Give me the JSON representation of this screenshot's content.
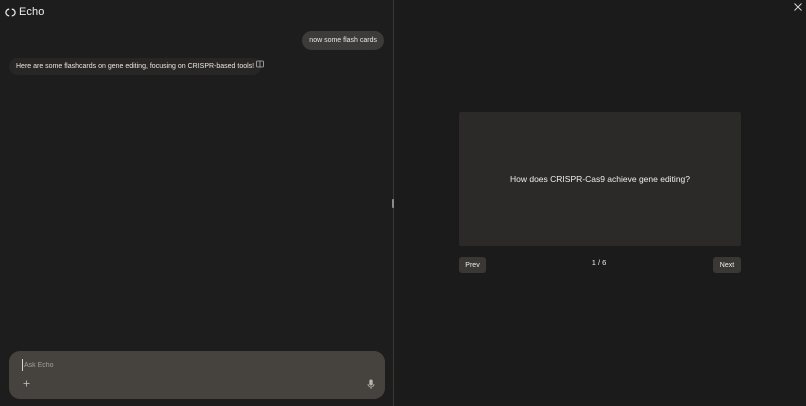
{
  "app": {
    "title": "Echo"
  },
  "chat": {
    "user_message": "now some flash cards",
    "assistant_message": "Here are some flashcards on gene editing, focusing on CRISPR-based tools!",
    "composer": {
      "placeholder": "Ask Echo",
      "value": ""
    }
  },
  "flashcards": {
    "question": "How does CRISPR-Cas9 achieve gene editing?",
    "counter": "1 / 6",
    "prev_label": "Prev",
    "next_label": "Next"
  },
  "icons": {
    "logo": "echo-logo-icon",
    "cards_toggle": "flashcards-panel-icon",
    "attach": "plus-icon",
    "mic": "microphone-icon",
    "close": "close-icon"
  },
  "colors": {
    "background": "#1e1d1d",
    "user_bubble": "#3d3b39",
    "composer": "#46433f",
    "card": "#2c2a28",
    "button": "#3a3835",
    "text": "#e9e7e4"
  }
}
